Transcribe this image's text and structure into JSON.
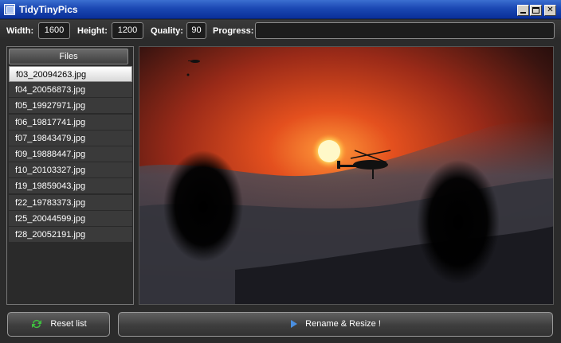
{
  "window": {
    "title": "TidyTinyPics"
  },
  "toolbar": {
    "width_label": "Width:",
    "width_value": "1600",
    "height_label": "Height:",
    "height_value": "1200",
    "quality_label": "Quality:",
    "quality_value": "90",
    "progress_label": "Progress:",
    "progress_value": 0
  },
  "files": {
    "header": "Files",
    "items": [
      "f03_20094263.jpg",
      "f04_20056873.jpg",
      "f05_19927971.jpg",
      "f06_19817741.jpg",
      "f07_19843479.jpg",
      "f09_19888447.jpg",
      "f10_20103327.jpg",
      "f19_19859043.jpg",
      "f22_19783373.jpg",
      "f25_20044599.jpg",
      "f28_20052191.jpg"
    ],
    "selected_index": 0
  },
  "buttons": {
    "reset_label": "Reset list",
    "rename_label": "Rename & Resize !"
  },
  "icons": {
    "app": "app-window-icon",
    "reset": "refresh-arrows-icon",
    "rename": "play-arrow-icon"
  },
  "colors": {
    "titlebar": "#0a2f99",
    "background": "#2b2b2b",
    "selected_item": "#ffffff",
    "reset_icon": "#3fbf3f",
    "rename_icon": "#4a8fe0"
  }
}
